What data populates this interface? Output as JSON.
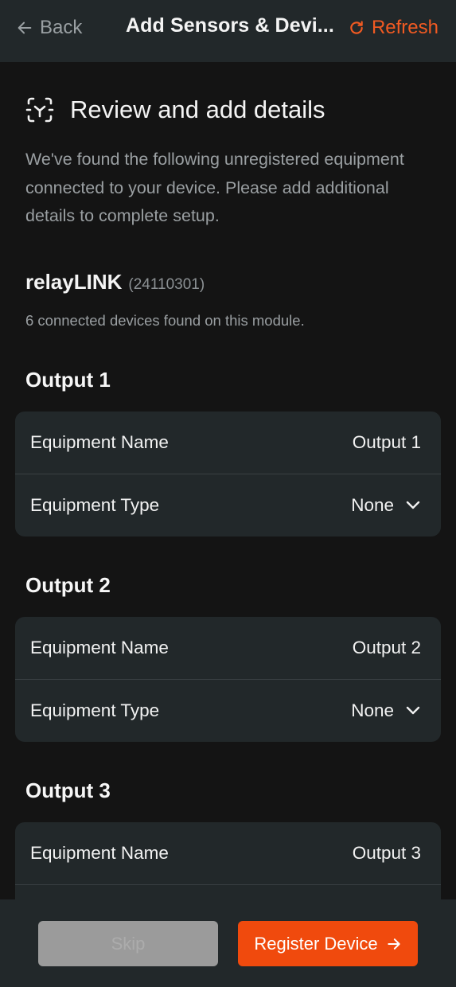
{
  "header": {
    "back_label": "Back",
    "title": "Add Sensors & Devi...",
    "refresh_label": "Refresh",
    "accent_color": "#f15a22"
  },
  "intro": {
    "title": "Review and add details",
    "description": "We've found the following unregistered equipment connected to your device. Please add additional details to complete setup.",
    "icon": "scan-icon"
  },
  "module": {
    "name": "relayLINK",
    "serial": "(24110301)",
    "count_text": "6 connected devices found on this module."
  },
  "outputs": [
    {
      "heading": "Output 1",
      "name_label": "Equipment Name",
      "name_value": "Output 1",
      "type_label": "Equipment Type",
      "type_value": "None"
    },
    {
      "heading": "Output 2",
      "name_label": "Equipment Name",
      "name_value": "Output 2",
      "type_label": "Equipment Type",
      "type_value": "None"
    },
    {
      "heading": "Output 3",
      "name_label": "Equipment Name",
      "name_value": "Output 3"
    }
  ],
  "footer": {
    "skip_label": "Skip",
    "register_label": "Register Device",
    "register_color": "#f04a0d"
  }
}
